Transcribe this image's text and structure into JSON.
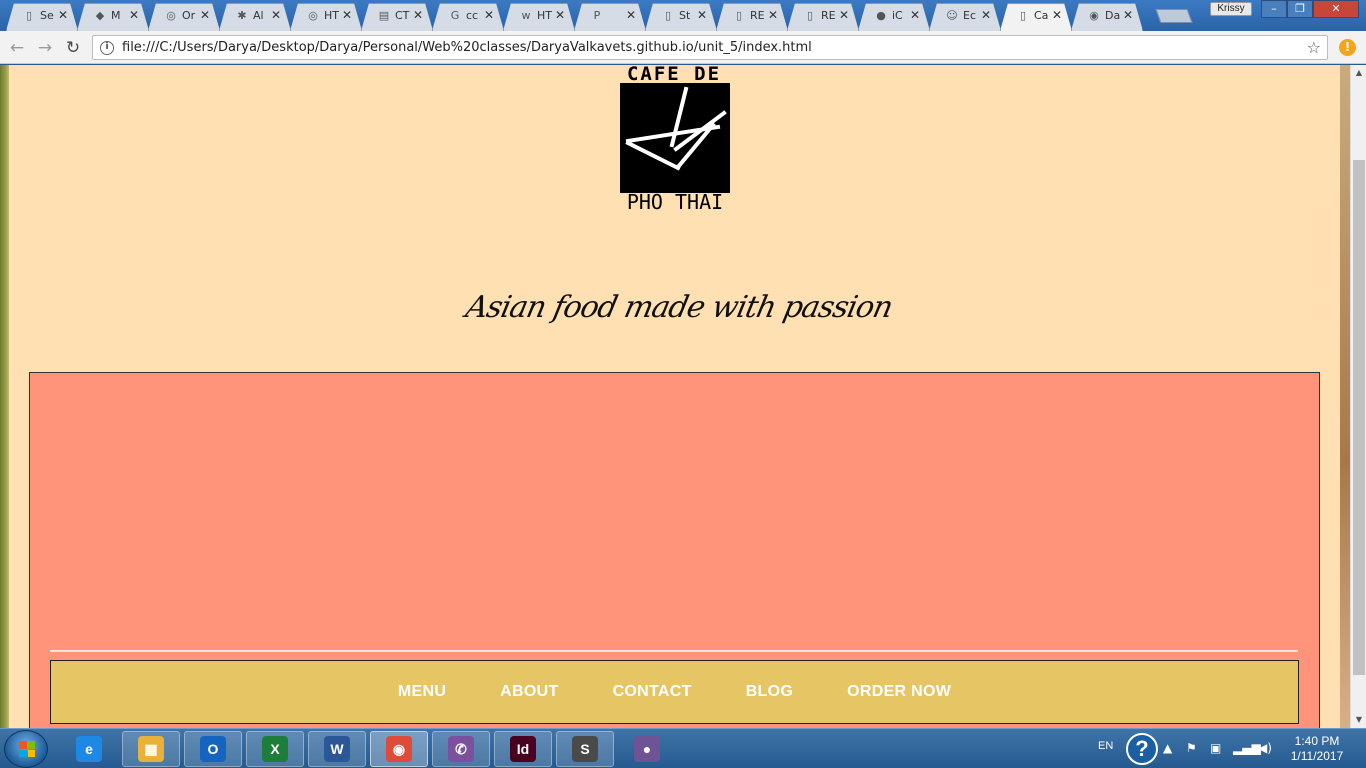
{
  "browser": {
    "tabs": [
      {
        "title": "Se",
        "icon": "page-icon"
      },
      {
        "title": "M",
        "icon": "brick-icon"
      },
      {
        "title": "Or",
        "icon": "ga-icon"
      },
      {
        "title": "Al",
        "icon": "asterisk-icon"
      },
      {
        "title": "HT",
        "icon": "ga-icon"
      },
      {
        "title": "CT",
        "icon": "doc-icon"
      },
      {
        "title": "cc",
        "icon": "google-icon"
      },
      {
        "title": "HT",
        "icon": "w3-icon"
      },
      {
        "title": "",
        "icon": "pandora-icon"
      },
      {
        "title": "St",
        "icon": "page-icon"
      },
      {
        "title": "RE",
        "icon": "page-icon"
      },
      {
        "title": "RE",
        "icon": "page-icon"
      },
      {
        "title": "iC",
        "icon": "apple-icon"
      },
      {
        "title": "Ec",
        "icon": "avatar-icon"
      },
      {
        "title": "Ca",
        "icon": "page-icon"
      },
      {
        "title": "Da",
        "icon": "github-icon"
      }
    ],
    "active_tab_index": 14,
    "profile_name": "Krissy",
    "url": "file:///C:/Users/Darya/Desktop/Darya/Personal/Web%20classes/DaryaValkavets.github.io/unit_5/index.html"
  },
  "page": {
    "logo_top_text": "CAFE DE",
    "logo_bottom_text": "PHO THAI",
    "tagline": "Asian food made with passion",
    "nav": [
      {
        "label": "MENU"
      },
      {
        "label": "ABOUT"
      },
      {
        "label": "CONTACT"
      },
      {
        "label": "BLOG"
      },
      {
        "label": "ORDER NOW"
      }
    ],
    "colors": {
      "page_background": "#ffe0b3",
      "hero_background": "#ff947a",
      "navbar_background": "#e6c565",
      "nav_text": "#ffffff"
    }
  },
  "taskbar": {
    "apps": [
      {
        "name": "internet-explorer",
        "glyph": "e",
        "color": "#1e88e5"
      },
      {
        "name": "file-explorer",
        "glyph": "▦",
        "color": "#e8b13a"
      },
      {
        "name": "outlook",
        "glyph": "O",
        "color": "#1565c0"
      },
      {
        "name": "excel",
        "glyph": "X",
        "color": "#1e7d3a"
      },
      {
        "name": "word",
        "glyph": "W",
        "color": "#2b5797"
      },
      {
        "name": "chrome",
        "glyph": "◉",
        "color": "#dd4b39"
      },
      {
        "name": "viber",
        "glyph": "✆",
        "color": "#7b519d"
      },
      {
        "name": "indesign",
        "glyph": "Id",
        "color": "#49021f"
      },
      {
        "name": "sublime-text",
        "glyph": "S",
        "color": "#4a4a4a"
      },
      {
        "name": "github-desktop",
        "glyph": "●",
        "color": "#6e5494"
      }
    ],
    "language": "EN",
    "time": "1:40 PM",
    "date": "1/11/2017"
  }
}
